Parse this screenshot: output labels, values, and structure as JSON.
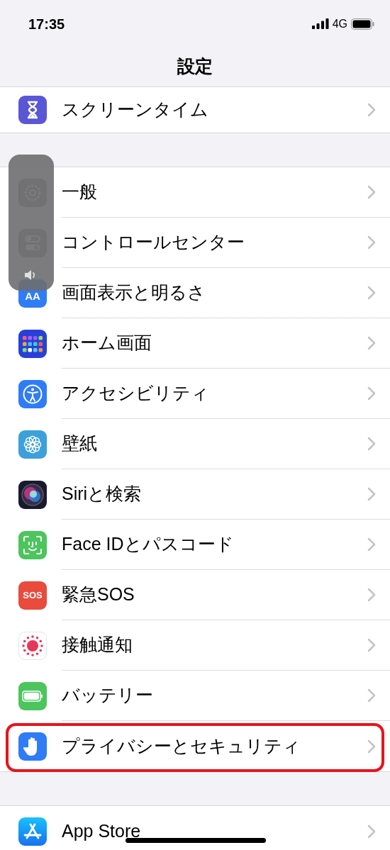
{
  "status_bar": {
    "time": "17:35",
    "network": "4G"
  },
  "nav": {
    "title": "設定"
  },
  "sections": [
    {
      "rows": [
        {
          "label": "スクリーンタイム",
          "kind": "hourglass",
          "highlighted": false
        }
      ]
    },
    {
      "rows": [
        {
          "label": "一般",
          "kind": "gear",
          "highlighted": false
        },
        {
          "label": "コントロールセンター",
          "kind": "toggles",
          "highlighted": false
        },
        {
          "label": "画面表示と明るさ",
          "kind": "display",
          "icon_text": "AA",
          "highlighted": false
        },
        {
          "label": "ホーム画面",
          "kind": "home",
          "highlighted": false
        },
        {
          "label": "アクセシビリティ",
          "kind": "accessibility",
          "highlighted": false
        },
        {
          "label": "壁紙",
          "kind": "flower",
          "highlighted": false
        },
        {
          "label": "Siriと検索",
          "kind": "siri",
          "highlighted": false
        },
        {
          "label": "Face IDとパスコード",
          "kind": "faceid",
          "highlighted": false
        },
        {
          "label": "緊急SOS",
          "kind": "sos",
          "icon_text": "SOS",
          "highlighted": false
        },
        {
          "label": "接触通知",
          "kind": "exposure",
          "highlighted": false
        },
        {
          "label": "バッテリー",
          "kind": "battery",
          "highlighted": false
        },
        {
          "label": "プライバシーとセキュリティ",
          "kind": "hand",
          "highlighted": true
        }
      ]
    },
    {
      "rows": [
        {
          "label": "App Store",
          "kind": "appstore",
          "highlighted": false
        }
      ]
    }
  ]
}
